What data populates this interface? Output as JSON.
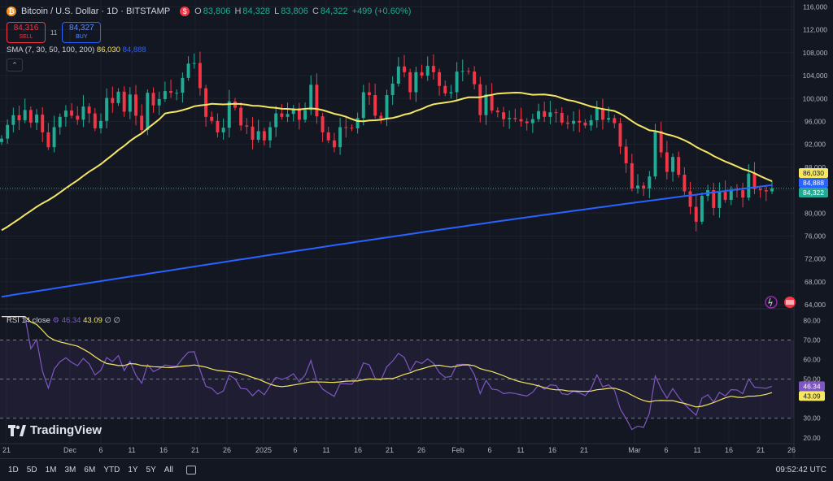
{
  "header": {
    "symbol": "Bitcoin / U.S. Dollar · 1D · BITSTAMP",
    "ohlc": [
      {
        "label": "O",
        "value": "83,806"
      },
      {
        "label": "H",
        "value": "84,328"
      },
      {
        "label": "L",
        "value": "83,806"
      },
      {
        "label": "C",
        "value": "84,322"
      }
    ],
    "change": "+499 (+0.60%)"
  },
  "trade": {
    "sell_price": "84,316",
    "sell_label": "SELL",
    "spread": "11",
    "buy_price": "84,327",
    "buy_label": "BUY"
  },
  "sma_legend": {
    "label": "SMA (7, 30, 50, 100, 200)",
    "v1": "86,030",
    "v2": "84,888"
  },
  "rsi_legend": {
    "label": "RSI 14 close",
    "v1": "46.34",
    "v2": "43.09",
    "v3": "∅ ∅"
  },
  "price_axis_badges": [
    "86,030",
    "84,888",
    "84,322"
  ],
  "rsi_axis_badges": [
    "46.34",
    "43.09"
  ],
  "logo_text": "TradingView",
  "bottom": {
    "ranges": [
      "1D",
      "5D",
      "1M",
      "3M",
      "6M",
      "YTD",
      "1Y",
      "5Y",
      "All"
    ],
    "clock": "09:52:42 UTC"
  },
  "colors": {
    "background": "#131722",
    "up": "#22ab94",
    "down": "#f23645",
    "sma_yellow": "#f5e663",
    "sma_blue": "#2962ff",
    "rsi": "#7e57c2",
    "rsi_ma": "#f5e663"
  },
  "chart_data": [
    {
      "type": "candlestick",
      "price_ticks": [
        116000,
        112000,
        108000,
        104000,
        100000,
        96000,
        92000,
        88000,
        84000,
        80000,
        76000,
        72000,
        68000,
        64000
      ],
      "ylim": [
        63300,
        117200
      ],
      "x_tick_labels": [
        "21",
        "Dec",
        "6",
        "11",
        "16",
        "21",
        "26",
        "2025",
        "6",
        "11",
        "16",
        "21",
        "26",
        "Feb",
        "6",
        "11",
        "16",
        "21",
        "Mar",
        "6",
        "11",
        "16",
        "21",
        "26"
      ],
      "closes": [
        93000,
        95400,
        97100,
        96200,
        98000,
        95800,
        97200,
        94100,
        91500,
        95000,
        96800,
        97900,
        97000,
        96300,
        98600,
        97400,
        94800,
        96100,
        100100,
        99200,
        101200,
        97700,
        100700,
        97000,
        94500,
        101000,
        98800,
        99900,
        101300,
        101000,
        101000,
        103600,
        106100,
        106200,
        101800,
        96800,
        96100,
        94100,
        94900,
        99500,
        98400,
        95300,
        95100,
        92800,
        94300,
        92700,
        95000,
        97400,
        96800,
        97300,
        98300,
        96300,
        98000,
        102400,
        96900,
        94100,
        92700,
        91500,
        95000,
        94900,
        94800,
        96600,
        101100,
        100600,
        97000,
        96500,
        100600,
        102600,
        105600,
        104600,
        101100,
        104600,
        104000,
        105700,
        104600,
        102200,
        100900,
        101100,
        104700,
        104800,
        104700,
        102500,
        97100,
        100700,
        97900,
        97600,
        96400,
        96600,
        96400,
        96000,
        95700,
        96400,
        97800,
        96800,
        97600,
        97500,
        95800,
        95600,
        96100,
        95800,
        95300,
        96200,
        98300,
        96300,
        96600,
        95700,
        91600,
        88700,
        84300,
        84800,
        84300,
        86400,
        94300,
        90600,
        87200,
        89800,
        86700,
        83800,
        81100,
        78500,
        83000,
        84000,
        80900,
        83700,
        82300,
        84100,
        84000,
        82700,
        86900,
        84200,
        84000,
        83800,
        84322
      ],
      "sma_yellow_values": {
        "start": 77000,
        "end": 86030
      },
      "sma_blue_values": {
        "start": 65400,
        "end": 84888
      }
    },
    {
      "type": "line",
      "name": "RSI 14 close",
      "ylim": [
        17,
        86
      ],
      "ticks": [
        80.0,
        70.0,
        60.0,
        50.0,
        40.0,
        30.0,
        20.0
      ],
      "bands": {
        "upper": 70,
        "middle": 50,
        "lower": 30
      },
      "last_rsi": 46.34,
      "last_rsi_ma": 43.09
    }
  ]
}
